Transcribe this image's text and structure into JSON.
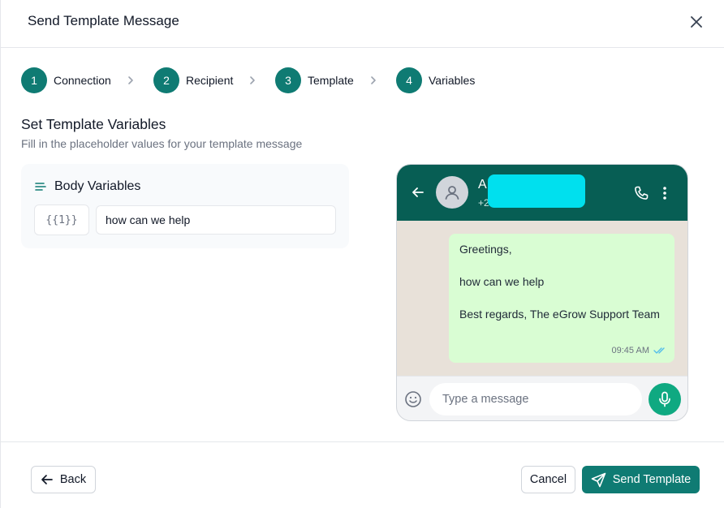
{
  "dialog": {
    "title": "Send Template Message",
    "close_icon": "close-icon"
  },
  "stepper": {
    "steps": [
      {
        "number": "1",
        "label": "Connection"
      },
      {
        "number": "2",
        "label": "Recipient"
      },
      {
        "number": "3",
        "label": "Template"
      },
      {
        "number": "4",
        "label": "Variables"
      }
    ]
  },
  "section": {
    "title": "Set Template Variables",
    "subtitle": "Fill in the placeholder values for your template message"
  },
  "body_variables": {
    "title": "Body Variables",
    "icon": "align-left-icon",
    "token": "{{1}}",
    "value": "how can we help"
  },
  "preview": {
    "contact_name": "A",
    "contact_number": "+2",
    "message_lines": [
      "Greetings,",
      "",
      "how can we help",
      "",
      "Best regards, The eGrow Support Team"
    ],
    "time": "09:45 AM",
    "compose_placeholder": "Type a message",
    "colors": {
      "header": "#075e54",
      "bubble": "#d9fdd3",
      "mic": "#0fa981",
      "redaction": "#00e0ee"
    }
  },
  "footer": {
    "back_label": "Back",
    "cancel_label": "Cancel",
    "send_label": "Send Template"
  },
  "colors": {
    "accent": "#0f7b73"
  }
}
